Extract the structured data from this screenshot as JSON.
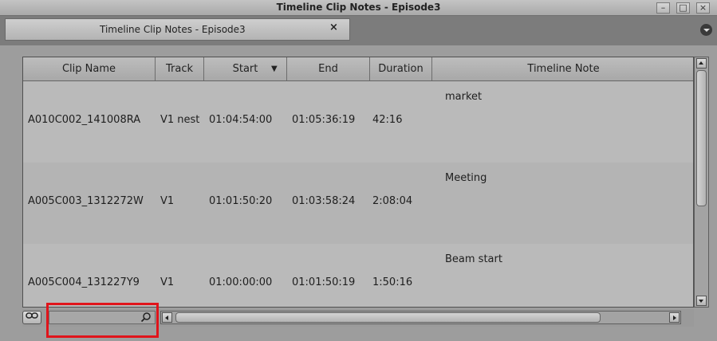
{
  "window": {
    "title": "Timeline Clip Notes - Episode3",
    "controls": {
      "minimize": "–",
      "maximize": "□",
      "close": "×"
    }
  },
  "tab": {
    "label": "Timeline Clip Notes - Episode3",
    "close": "×"
  },
  "columns": [
    "Clip Name",
    "Track",
    "Start",
    "End",
    "Duration",
    "Timeline Note"
  ],
  "sort_indicator": "▼",
  "rows": [
    {
      "clip": "A010C002_141008RA",
      "track": "V1 nest",
      "start": "01:04:54:00",
      "end": "01:05:36:19",
      "duration": "42:16",
      "note": "market"
    },
    {
      "clip": "A005C003_1312272W",
      "track": "V1",
      "start": "01:01:50:20",
      "end": "01:03:58:24",
      "duration": "2:08:04",
      "note": "Meeting"
    },
    {
      "clip": "A005C004_131227Y9",
      "track": "V1",
      "start": "01:00:00:00",
      "end": "01:01:50:19",
      "duration": "1:50:16",
      "note": "Beam start"
    }
  ],
  "bottom": {
    "link_icon": "link-icon",
    "search_value": "",
    "search_icon": "search-icon"
  },
  "colors": {
    "highlight": "#e0141b"
  }
}
